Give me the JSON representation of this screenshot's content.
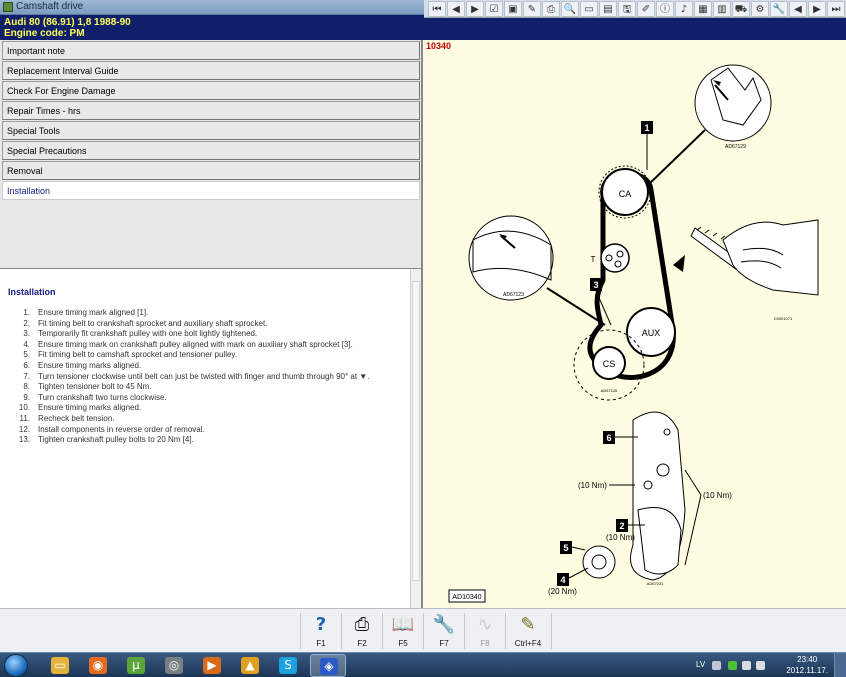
{
  "window": {
    "title": "Camshaft drive"
  },
  "header": {
    "line1": "Audi   80 (86.91) 1,8   1988-90",
    "line2": "Engine code: PM"
  },
  "toolbar": {
    "buttons": [
      "first-icon",
      "prev-icon",
      "play-icon",
      "checkbox-icon",
      "image-icon",
      "pen-icon",
      "print-icon",
      "search-icon",
      "window-icon",
      "monitor-icon",
      "save-icon",
      "brush-icon",
      "info-icon",
      "sound-icon",
      "doc-icon",
      "folder-icon",
      "car-icon",
      "gear-icon",
      "wrench-icon",
      "back-icon",
      "next-icon",
      "last-icon"
    ],
    "glyphs": [
      "⏮",
      "◀",
      "▶",
      "☑",
      "▣",
      "✎",
      "⎙",
      "🔍",
      "▭",
      "▤",
      "🖫",
      "✐",
      "ⓘ",
      "♪",
      "▦",
      "▥",
      "⛟",
      "⚙",
      "🔧",
      "◀",
      "▶",
      "⏭"
    ]
  },
  "menu": {
    "items": [
      {
        "label": "Important note"
      },
      {
        "label": "Replacement Interval Guide"
      },
      {
        "label": "Check For Engine Damage"
      },
      {
        "label": "Repair Times - hrs"
      },
      {
        "label": "Special Tools"
      },
      {
        "label": "Special Precautions"
      },
      {
        "label": "Removal"
      },
      {
        "label": "Installation"
      }
    ],
    "active_index": 7
  },
  "instructions": {
    "heading": "Installation",
    "steps": [
      {
        "num": "1.",
        "text": "Ensure timing mark aligned [1]."
      },
      {
        "num": "2.",
        "text": "Fit timing belt to crankshaft sprocket and auxiliary shaft sprocket."
      },
      {
        "num": "3.",
        "text": "Temporarily fit crankshaft pulley with one bolt lightly tightened."
      },
      {
        "num": "4.",
        "text": "Ensure timing mark on crankshaft pulley aligned with mark on auxiliary shaft sprocket [3]."
      },
      {
        "num": "5.",
        "text": "Fit timing belt to camshaft sprocket and tensioner pulley."
      },
      {
        "num": "6.",
        "text": "Ensure timing marks aligned."
      },
      {
        "num": "7.",
        "text": "Turn tensioner clockwise until belt can just be twisted with finger and thumb through 90° at ▼."
      },
      {
        "num": "8.",
        "text": "Tighten tensioner bolt to 45 Nm."
      },
      {
        "num": "9.",
        "text": "Turn crankshaft two turns clockwise."
      },
      {
        "num": "10.",
        "text": "Ensure timing marks aligned."
      },
      {
        "num": "11.",
        "text": "Recheck belt tension."
      },
      {
        "num": "12.",
        "text": "Install components in reverse order of removal."
      },
      {
        "num": "13.",
        "text": "Tighten crankshaft pulley bolts to 20 Nm [4]."
      }
    ]
  },
  "diagram": {
    "code": "10340",
    "pulleys": {
      "ca": "CA",
      "t": "T",
      "aux": "AUX",
      "cs": "CS"
    },
    "callouts": {
      "c1": "1",
      "c2": "2",
      "c3": "3",
      "c4": "4",
      "c5": "5",
      "c6": "6"
    },
    "torques": {
      "a": "(10 Nm)",
      "b": "(10 Nm)",
      "c": "(10 Nm)",
      "d": "(20 Nm)"
    },
    "refs": {
      "r1": "AD67129",
      "r2": "AD67123",
      "r3": "AD67126",
      "r4": "C0001071",
      "r5": "AD67031"
    },
    "footer_code": "AD10340"
  },
  "fkeys": [
    {
      "label": "F1",
      "icon": "help-icon",
      "glyph": "?",
      "enabled": true
    },
    {
      "label": "F2",
      "icon": "print-icon",
      "glyph": "⎙",
      "enabled": true
    },
    {
      "label": "F5",
      "icon": "book-icon",
      "glyph": "📖",
      "enabled": true
    },
    {
      "label": "F7",
      "icon": "tools-icon",
      "glyph": "🔧",
      "enabled": true
    },
    {
      "label": "F8",
      "icon": "graph-icon",
      "glyph": "∿",
      "enabled": false
    },
    {
      "label": "Ctrl+F4",
      "icon": "notepad-icon",
      "glyph": "✎",
      "enabled": true
    }
  ],
  "taskbar": {
    "apps": [
      {
        "name": "explorer-icon",
        "color": "#e3b23c",
        "glyph": "▭"
      },
      {
        "name": "firefox-icon",
        "color": "#e56b1f",
        "glyph": "◉"
      },
      {
        "name": "utorrent-icon",
        "color": "#5ba43a",
        "glyph": "µ"
      },
      {
        "name": "app-disk-icon",
        "color": "#7a7f86",
        "glyph": "◎"
      },
      {
        "name": "media-player-icon",
        "color": "#d86a1a",
        "glyph": "▶"
      },
      {
        "name": "autodata-icon",
        "color": "#e0a020",
        "glyph": "▲"
      },
      {
        "name": "skype-icon",
        "color": "#1aa3e0",
        "glyph": "S"
      },
      {
        "name": "active-app-icon",
        "color": "#2a5ac8",
        "glyph": "◈"
      }
    ],
    "lang": "LV",
    "time": "23:40",
    "date": "2012.11.17."
  }
}
